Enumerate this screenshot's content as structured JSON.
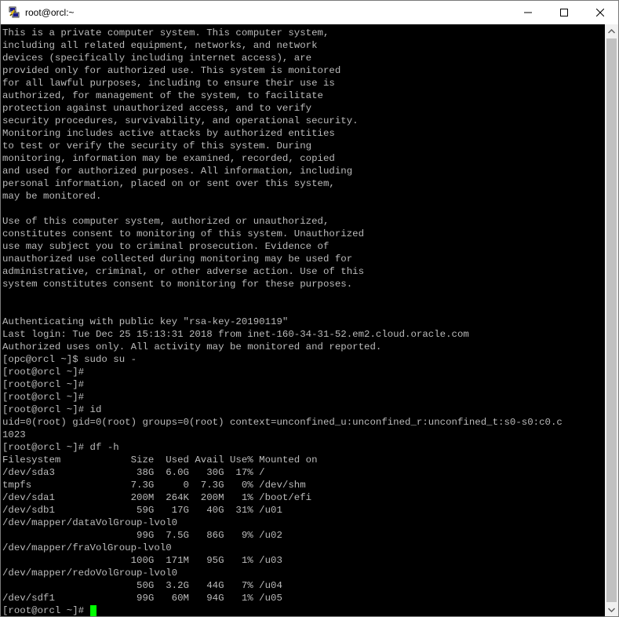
{
  "window": {
    "title": "root@orcl:~"
  },
  "icons": {
    "app": "putty-icon",
    "minimize": "minimize-icon",
    "maximize": "maximize-icon",
    "close": "close-icon",
    "scroll_up": "scroll-up-arrow-icon",
    "scroll_down": "scroll-down-arrow-icon"
  },
  "colors": {
    "terminal_bg": "#000000",
    "terminal_fg": "#bbbbbb",
    "cursor": "#00ff00"
  },
  "terminal": {
    "lines": [
      "This is a private computer system. This computer system,",
      "including all related equipment, networks, and network",
      "devices (specifically including internet access), are",
      "provided only for authorized use. This system is monitored",
      "for all lawful purposes, including to ensure their use is",
      "authorized, for management of the system, to facilitate",
      "protection against unauthorized access, and to verify",
      "security procedures, survivability, and operational security.",
      "Monitoring includes active attacks by authorized entities",
      "to test or verify the security of this system. During",
      "monitoring, information may be examined, recorded, copied",
      "and used for authorized purposes. All information, including",
      "personal information, placed on or sent over this system,",
      "may be monitored.",
      "",
      "Use of this computer system, authorized or unauthorized,",
      "constitutes consent to monitoring of this system. Unauthorized",
      "use may subject you to criminal prosecution. Evidence of",
      "unauthorized use collected during monitoring may be used for",
      "administrative, criminal, or other adverse action. Use of this",
      "system constitutes consent to monitoring for these purposes.",
      "",
      "",
      "Authenticating with public key \"rsa-key-20190119\"",
      "Last login: Tue Dec 25 15:13:31 2018 from inet-160-34-31-52.em2.cloud.oracle.com",
      "Authorized uses only. All activity may be monitored and reported.",
      "[opc@orcl ~]$ sudo su -",
      "[root@orcl ~]#",
      "[root@orcl ~]#",
      "[root@orcl ~]#",
      "[root@orcl ~]# id",
      "uid=0(root) gid=0(root) groups=0(root) context=unconfined_u:unconfined_r:unconfined_t:s0-s0:c0.c",
      "1023",
      "[root@orcl ~]# df -h",
      "Filesystem            Size  Used Avail Use% Mounted on",
      "/dev/sda3              38G  6.0G   30G  17% /",
      "tmpfs                 7.3G     0  7.3G   0% /dev/shm",
      "/dev/sda1             200M  264K  200M   1% /boot/efi",
      "/dev/sdb1              59G   17G   40G  31% /u01",
      "/dev/mapper/dataVolGroup-lvol0",
      "                       99G  7.5G   86G   9% /u02",
      "/dev/mapper/fraVolGroup-lvol0",
      "                      100G  171M   95G   1% /u03",
      "/dev/mapper/redoVolGroup-lvol0",
      "                       50G  3.2G   44G   7% /u04",
      "/dev/sdf1              99G   60M   94G   1% /u05",
      "[root@orcl ~]# "
    ]
  }
}
